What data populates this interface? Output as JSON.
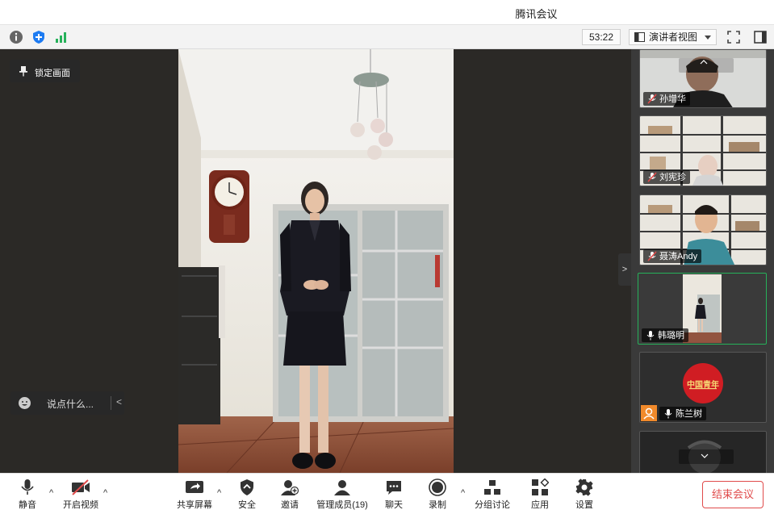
{
  "window": {
    "title": "腾讯会议"
  },
  "top_toolbar": {
    "timer": "53:22",
    "view_mode": "演讲者视图",
    "icons": [
      "info-icon",
      "shield-icon",
      "signal-icon",
      "fullscreen-icon",
      "sidebar-toggle-icon"
    ]
  },
  "stage": {
    "lock_label": "锁定画面",
    "chat_placeholder": "说点什么..."
  },
  "participants": [
    {
      "name": "孙增华",
      "muted": true
    },
    {
      "name": "刘宪珍",
      "muted": true
    },
    {
      "name": "聂涛Andy",
      "muted": true
    },
    {
      "name": "韩璐明",
      "muted": false,
      "active": true
    },
    {
      "name": "陈兰树",
      "muted": false,
      "logo_text": "中国青年"
    },
    {
      "name": "",
      "muted": false
    }
  ],
  "bottom_toolbar": {
    "mute": "静音",
    "video": "开启视频",
    "share": "共享屏幕",
    "security": "安全",
    "invite": "邀请",
    "members": "管理成员(19)",
    "chat": "聊天",
    "record": "录制",
    "breakout": "分组讨论",
    "apps": "应用",
    "settings": "设置",
    "end": "结束会议"
  },
  "colors": {
    "accent_green": "#26b15a",
    "end_red": "#e04b4b",
    "shield_blue": "#1d7bf2"
  }
}
